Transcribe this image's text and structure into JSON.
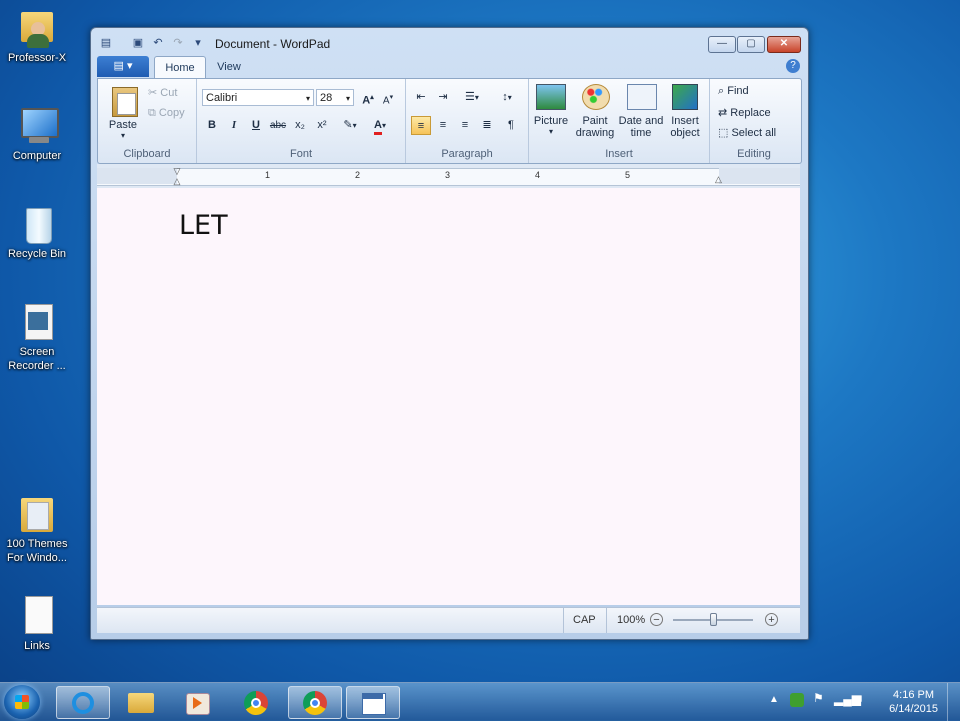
{
  "desktop": {
    "icons": [
      {
        "label": "Professor-X"
      },
      {
        "label": "Computer"
      },
      {
        "label": "Recycle Bin"
      },
      {
        "label": "Screen Recorder ..."
      },
      {
        "label": "100 Themes For Windo..."
      },
      {
        "label": "Links"
      }
    ]
  },
  "window": {
    "title": "Document - WordPad",
    "tabs": {
      "home": "Home",
      "view": "View"
    },
    "clipboard": {
      "paste": "Paste",
      "cut": "Cut",
      "copy": "Copy",
      "group": "Clipboard"
    },
    "font": {
      "family": "Calibri",
      "size": "28",
      "group": "Font",
      "bold": "B",
      "italic": "I",
      "underline": "U",
      "strike": "abc",
      "sub": "x₂",
      "sup": "x²"
    },
    "paragraph": {
      "group": "Paragraph"
    },
    "insert": {
      "picture": "Picture",
      "paint": "Paint drawing",
      "datetime": "Date and time",
      "object": "Insert object",
      "group": "Insert"
    },
    "editing": {
      "find": "Find",
      "replace": "Replace",
      "select_all": "Select all",
      "group": "Editing"
    },
    "ruler_numbers": [
      "1",
      "2",
      "3",
      "4",
      "5"
    ],
    "document_text": "LET",
    "status": {
      "cap": "CAP",
      "zoom": "100%"
    },
    "zoom_fraction": 0.5
  },
  "taskbar": {
    "time": "4:16 PM",
    "date": "6/14/2015"
  },
  "colors": {
    "accent": "#1f5cb2",
    "font_color_bar": "#e02020"
  }
}
